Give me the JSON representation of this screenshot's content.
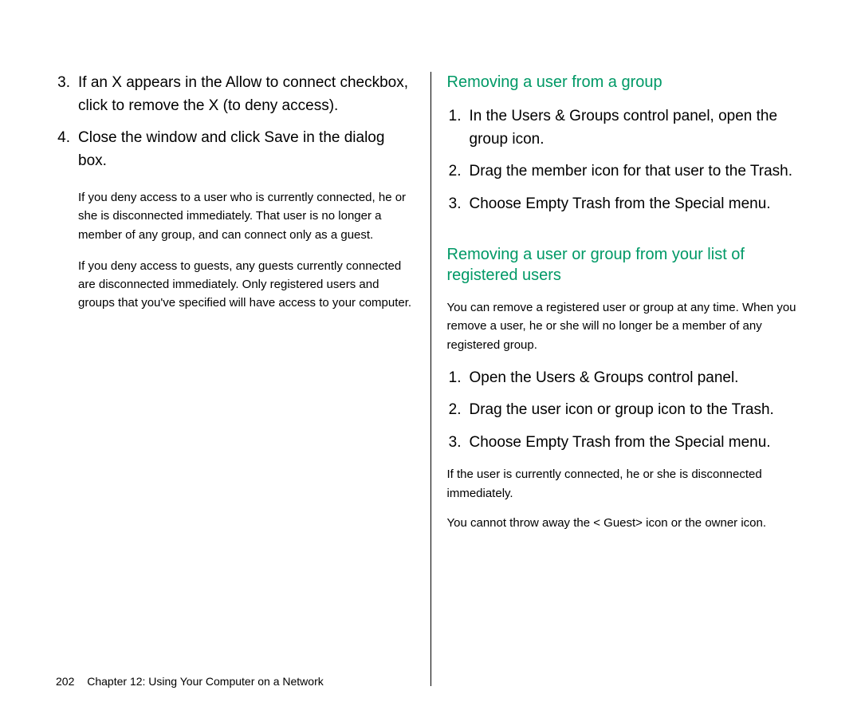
{
  "left_col": {
    "items": [
      {
        "num": "3.",
        "text": "If an X appears in the  Allow to connect  checkbox, click to remove the X (to deny access)."
      },
      {
        "num": "4.",
        "text": "Close the window and click Save in the dialog box."
      }
    ],
    "notes": [
      "If you deny access to a user who is currently connected, he or she is disconnected immediately. That user is no longer a member of any group, and can connect only as a guest.",
      "If you deny access to guests, any guests currently connected are disconnected immediately. Only registered users and groups that you've specified will have access to your computer."
    ]
  },
  "right_col": {
    "section1": {
      "heading": "Removing a user from a group",
      "items": [
        {
          "num": "1.",
          "text": "In the Users & Groups control panel, open the group icon."
        },
        {
          "num": "2.",
          "text": "Drag the member icon for that user to the Trash."
        },
        {
          "num": "3.",
          "text": "Choose Empty Trash from the Special menu."
        }
      ]
    },
    "section2": {
      "heading": "Removing a user or group from your list of registered users",
      "intro": "You can remove a registered user or group at any time. When you remove a user, he or she will no longer be a member of any registered group.",
      "items": [
        {
          "num": "1.",
          "text": "Open the Users & Groups control panel."
        },
        {
          "num": "2.",
          "text": "Drag the user icon or group icon to the Trash."
        },
        {
          "num": "3.",
          "text": "Choose Empty Trash from the Special menu."
        }
      ],
      "after_notes": [
        "If the user is currently connected, he or she is disconnected immediately.",
        "You cannot throw away the < Guest>   icon or the owner icon."
      ]
    }
  },
  "footer": {
    "page": "202",
    "chapter": "Chapter 12: Using Your Computer on a Network"
  }
}
